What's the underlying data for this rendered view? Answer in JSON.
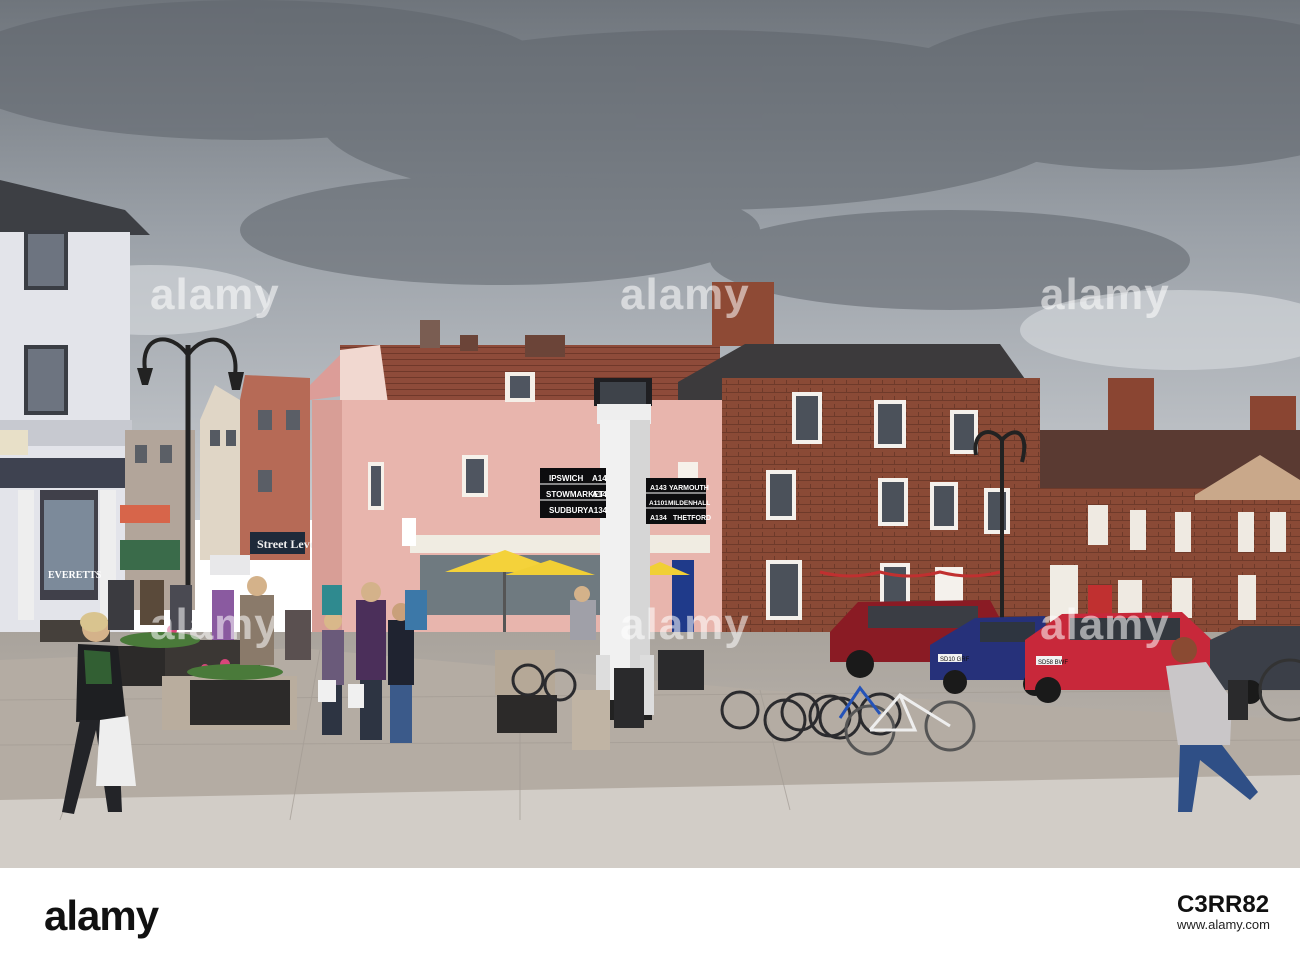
{
  "photo": {
    "subject": "town-square-street-scene",
    "watermark_text": "alamy"
  },
  "signpost": {
    "left_rows": [
      {
        "place": "IPSWICH",
        "road": "A14"
      },
      {
        "place": "STOWMARKET",
        "road": "A14"
      },
      {
        "place": "SUDBURY",
        "road": "A134"
      }
    ],
    "right_rows": [
      {
        "road": "A143",
        "place": "YARMOUTH"
      },
      {
        "road": "A1101",
        "place": "MILDENHALL"
      },
      {
        "road": "A134",
        "place": "THETFORD"
      }
    ]
  },
  "shop_signs": {
    "street_level": "Street Level",
    "everetts": "EVERETTS"
  },
  "plates": [
    "SD10 GRF",
    "SD58 BWF"
  ],
  "footer": {
    "logo": "alamy",
    "image_id": "C3RR82",
    "site": "www.alamy.com"
  },
  "colors": {
    "sky": "#9aa0a6",
    "pink_building": "#e6b2a8",
    "brick": "#8a4a36",
    "pavement": "#b4aca3"
  }
}
